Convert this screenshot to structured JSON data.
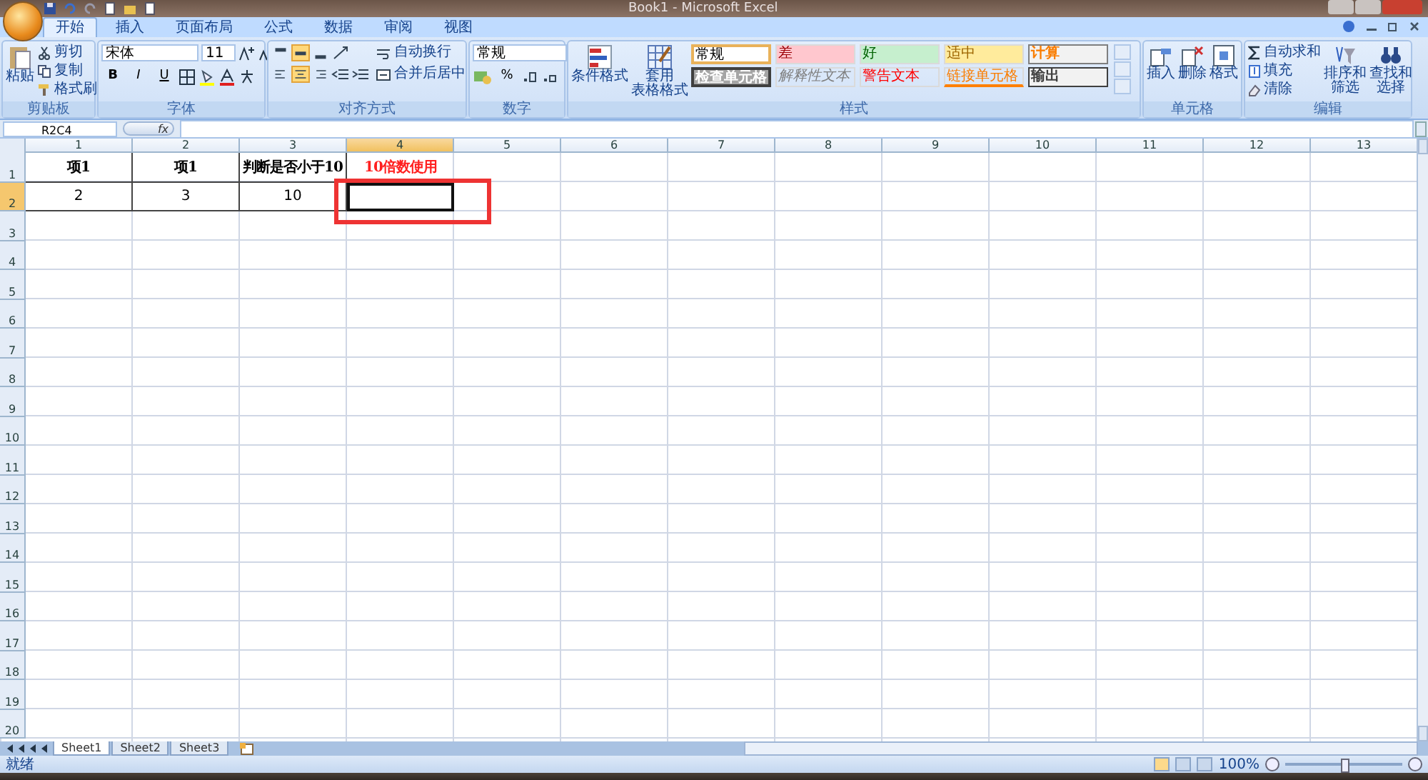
{
  "window": {
    "title": "Book1 - Microsoft Excel"
  },
  "tabs": [
    {
      "label": "开始",
      "selected": true
    },
    {
      "label": "插入",
      "selected": false
    },
    {
      "label": "页面布局",
      "selected": false
    },
    {
      "label": "公式",
      "selected": false
    },
    {
      "label": "数据",
      "selected": false
    },
    {
      "label": "审阅",
      "selected": false
    },
    {
      "label": "视图",
      "selected": false
    }
  ],
  "ribbon": {
    "clipboard": {
      "label": "剪贴板",
      "paste": "粘贴",
      "items": [
        "剪切",
        "复制",
        "格式刷"
      ]
    },
    "font": {
      "label": "字体",
      "font_name": "宋体",
      "font_size": "11",
      "styles": [
        "B",
        "I",
        "U"
      ]
    },
    "alignment": {
      "label": "对齐方式",
      "wrap": "自动换行",
      "merge": "合并后居中",
      "vertical": [
        {
          "selected": false
        },
        {
          "selected": true
        },
        {
          "selected": false
        }
      ],
      "horizontal": [
        {
          "selected": false
        },
        {
          "selected": true
        },
        {
          "selected": false
        }
      ]
    },
    "number": {
      "label": "数字",
      "format": "常规",
      "percent": "%"
    },
    "styles": {
      "label": "样式",
      "conditional": "条件格式",
      "table": [
        "套用",
        "表格格式"
      ],
      "gallery": [
        {
          "label": "常规",
          "kind": "normal",
          "selected": true
        },
        {
          "label": "差",
          "kind": "bad",
          "selected": false
        },
        {
          "label": "好",
          "kind": "good",
          "selected": false
        },
        {
          "label": "适中",
          "kind": "neutral",
          "selected": false
        },
        {
          "label": "计算",
          "kind": "calc",
          "selected": false
        },
        {
          "label": "检查单元格",
          "kind": "check",
          "selected": false
        },
        {
          "label": "解释性文本",
          "kind": "explanatory",
          "selected": false
        },
        {
          "label": "警告文本",
          "kind": "warning",
          "selected": false
        },
        {
          "label": "链接单元格",
          "kind": "linked",
          "selected": false
        },
        {
          "label": "输出",
          "kind": "output",
          "selected": false
        }
      ]
    },
    "cells": {
      "label": "单元格",
      "items": [
        "插入",
        "删除",
        "格式"
      ]
    },
    "editing": {
      "label": "编辑",
      "items": [
        "自动求和",
        "填充",
        "清除"
      ],
      "big": [
        [
          "排序和",
          "筛选"
        ],
        [
          "查找和",
          "选择"
        ]
      ]
    }
  },
  "formula_bar": {
    "name_box": "R2C4",
    "function_label": "fx"
  },
  "sheet": {
    "columns": [
      {
        "label": "1",
        "selected": false
      },
      {
        "label": "2",
        "selected": false
      },
      {
        "label": "3",
        "selected": false
      },
      {
        "label": "4",
        "selected": true
      },
      {
        "label": "5",
        "selected": false
      },
      {
        "label": "6",
        "selected": false
      },
      {
        "label": "7",
        "selected": false
      },
      {
        "label": "8",
        "selected": false
      },
      {
        "label": "9",
        "selected": false
      },
      {
        "label": "10",
        "selected": false
      },
      {
        "label": "11",
        "selected": false
      },
      {
        "label": "12",
        "selected": false
      },
      {
        "label": "13",
        "selected": false
      }
    ],
    "rows": [
      {
        "label": "1",
        "selected": false,
        "cells": [
          {
            "text": "项1",
            "bold": true
          },
          {
            "text": "项1",
            "bold": true
          },
          {
            "text": "判断是否小于10",
            "bold": true
          },
          {
            "text": "10倍数使用",
            "bold": true,
            "color": "#ff2020"
          }
        ]
      },
      {
        "label": "2",
        "selected": true,
        "cells": [
          {
            "text": "2",
            "bold": false
          },
          {
            "text": "3",
            "bold": false
          },
          {
            "text": "10",
            "bold": false
          }
        ]
      },
      {
        "label": "3",
        "selected": false
      },
      {
        "label": "4",
        "selected": false
      },
      {
        "label": "5",
        "selected": false
      },
      {
        "label": "6",
        "selected": false
      },
      {
        "label": "7",
        "selected": false
      },
      {
        "label": "8",
        "selected": false
      },
      {
        "label": "9",
        "selected": false
      },
      {
        "label": "10",
        "selected": false
      },
      {
        "label": "11",
        "selected": false
      },
      {
        "label": "12",
        "selected": false
      },
      {
        "label": "13",
        "selected": false
      },
      {
        "label": "14",
        "selected": false
      },
      {
        "label": "15",
        "selected": false
      },
      {
        "label": "16",
        "selected": false
      },
      {
        "label": "17",
        "selected": false
      },
      {
        "label": "18",
        "selected": false
      },
      {
        "label": "19",
        "selected": false
      },
      {
        "label": "20",
        "selected": false
      }
    ]
  },
  "sheet_tabs": [
    {
      "label": "Sheet1",
      "selected": true
    },
    {
      "label": "Sheet2",
      "selected": false
    },
    {
      "label": "Sheet3",
      "selected": false
    }
  ],
  "status_bar": {
    "text": "就绪",
    "zoom": "100%",
    "zoom_slider": {
      "level": 0.5
    }
  }
}
